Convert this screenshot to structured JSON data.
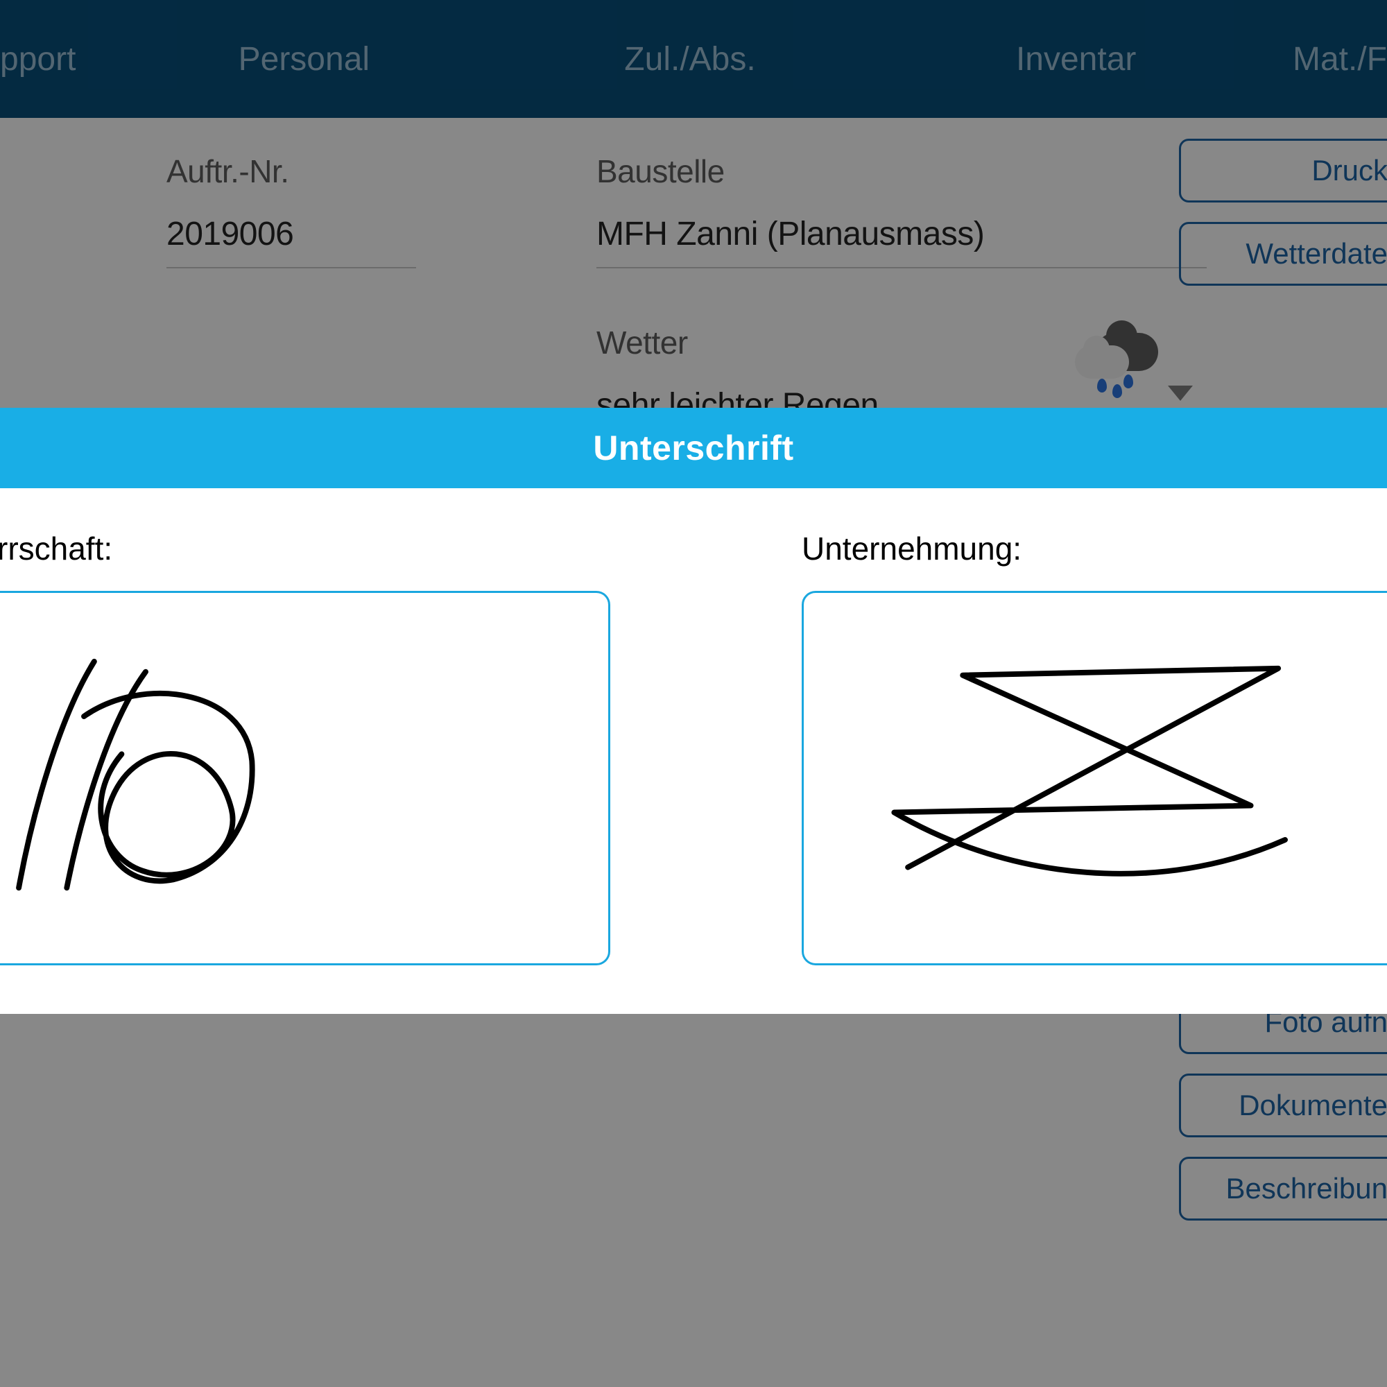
{
  "topbar": {
    "tabs": [
      "pport",
      "Personal",
      "Zul./Abs.",
      "Inventar",
      "Mat./F"
    ]
  },
  "form": {
    "auftr_label": "Auftr.-Nr.",
    "auftr_value": "2019006",
    "baustelle_label": "Baustelle",
    "baustelle_value": "MFH Zanni (Planausmass)",
    "wetter_label": "Wetter",
    "wetter_value": "sehr leichter Regen"
  },
  "right_buttons_top": [
    "Druck",
    "Wetterdate"
  ],
  "right_buttons_bottom": [
    "Foto aufn",
    "Dokumente",
    "Beschreibun"
  ],
  "dialog": {
    "title": "Unterschrift",
    "left_label": "rrschaft:",
    "right_label": "Unternehmung:"
  }
}
